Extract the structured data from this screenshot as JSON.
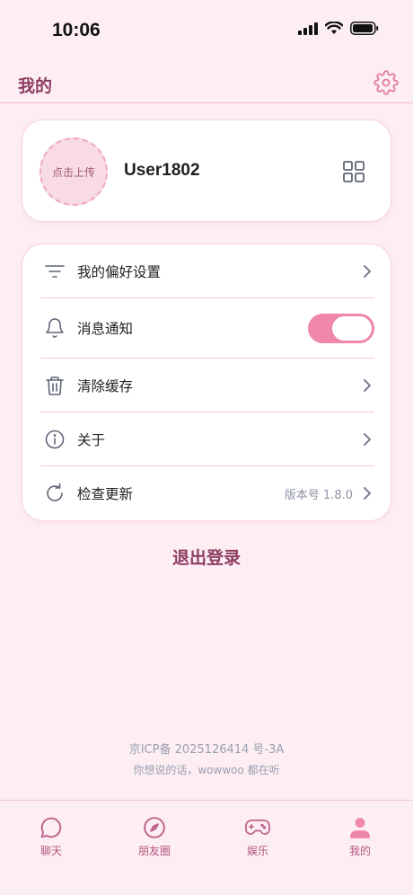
{
  "status_bar": {
    "time": "10:06"
  },
  "header": {
    "title": "我的"
  },
  "profile": {
    "avatar_label": "点击上传",
    "username": "User1802"
  },
  "settings": {
    "items": [
      {
        "label": "我的偏好设置"
      },
      {
        "label": "消息通知",
        "toggle_on": true
      },
      {
        "label": "清除缓存"
      },
      {
        "label": "关于"
      },
      {
        "label": "检查更新",
        "value": "版本号 1.8.0"
      }
    ]
  },
  "logout_label": "退出登录",
  "footer": {
    "icp": "京ICP备 2025126414 号-3A",
    "tagline": "你想说的话，wowwoo 都在听"
  },
  "tabs": [
    {
      "label": "聊天",
      "icon": "chat-bubble-icon"
    },
    {
      "label": "朋友圈",
      "icon": "compass-icon"
    },
    {
      "label": "娱乐",
      "icon": "gamepad-icon"
    },
    {
      "label": "我的",
      "icon": "person-icon",
      "active": true
    }
  ],
  "colors": {
    "background": "#fdeef3",
    "accent": "#ef86ac",
    "title": "#8e3d62",
    "tab_label": "#b2557c"
  }
}
